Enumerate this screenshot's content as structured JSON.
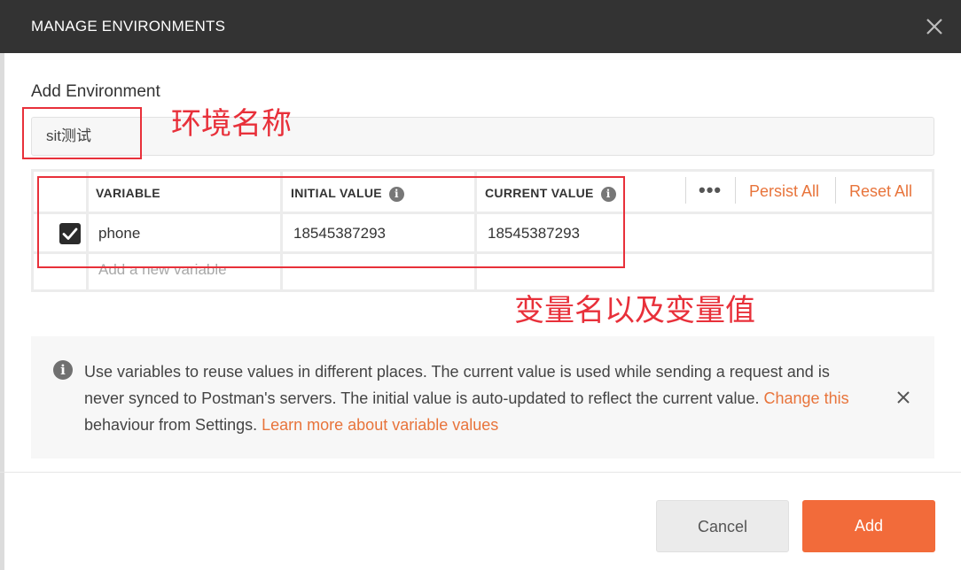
{
  "dialog": {
    "title": "MANAGE ENVIRONMENTS",
    "section_label": "Add Environment",
    "environment_name": "sit测试"
  },
  "table": {
    "headers": {
      "variable": "VARIABLE",
      "initial_value": "INITIAL VALUE",
      "current_value": "CURRENT VALUE"
    },
    "info_glyph": "i",
    "more_menu": "•••",
    "persist_all": "Persist All",
    "reset_all": "Reset All",
    "rows": [
      {
        "enabled": true,
        "variable": "phone",
        "initial_value": "18545387293",
        "current_value": "18545387293"
      }
    ],
    "new_variable_placeholder": "Add a new variable"
  },
  "annotations": {
    "env_name_note": "环境名称",
    "variables_note": "变量名以及变量值",
    "color": "#e8303a"
  },
  "notice": {
    "text_part1": "Use variables to reuse values in different places. The current value is used while sending a request and is never synced to Postman's servers. The initial value is auto-updated to reflect the current value. ",
    "link_change": "Change this",
    "text_part2": " behaviour from Settings. ",
    "link_learn": "Learn more about variable values"
  },
  "footer": {
    "cancel_label": "Cancel",
    "add_label": "Add"
  },
  "colors": {
    "header_bg": "#333333",
    "accent": "#f26b3a",
    "link": "#e8743b"
  }
}
